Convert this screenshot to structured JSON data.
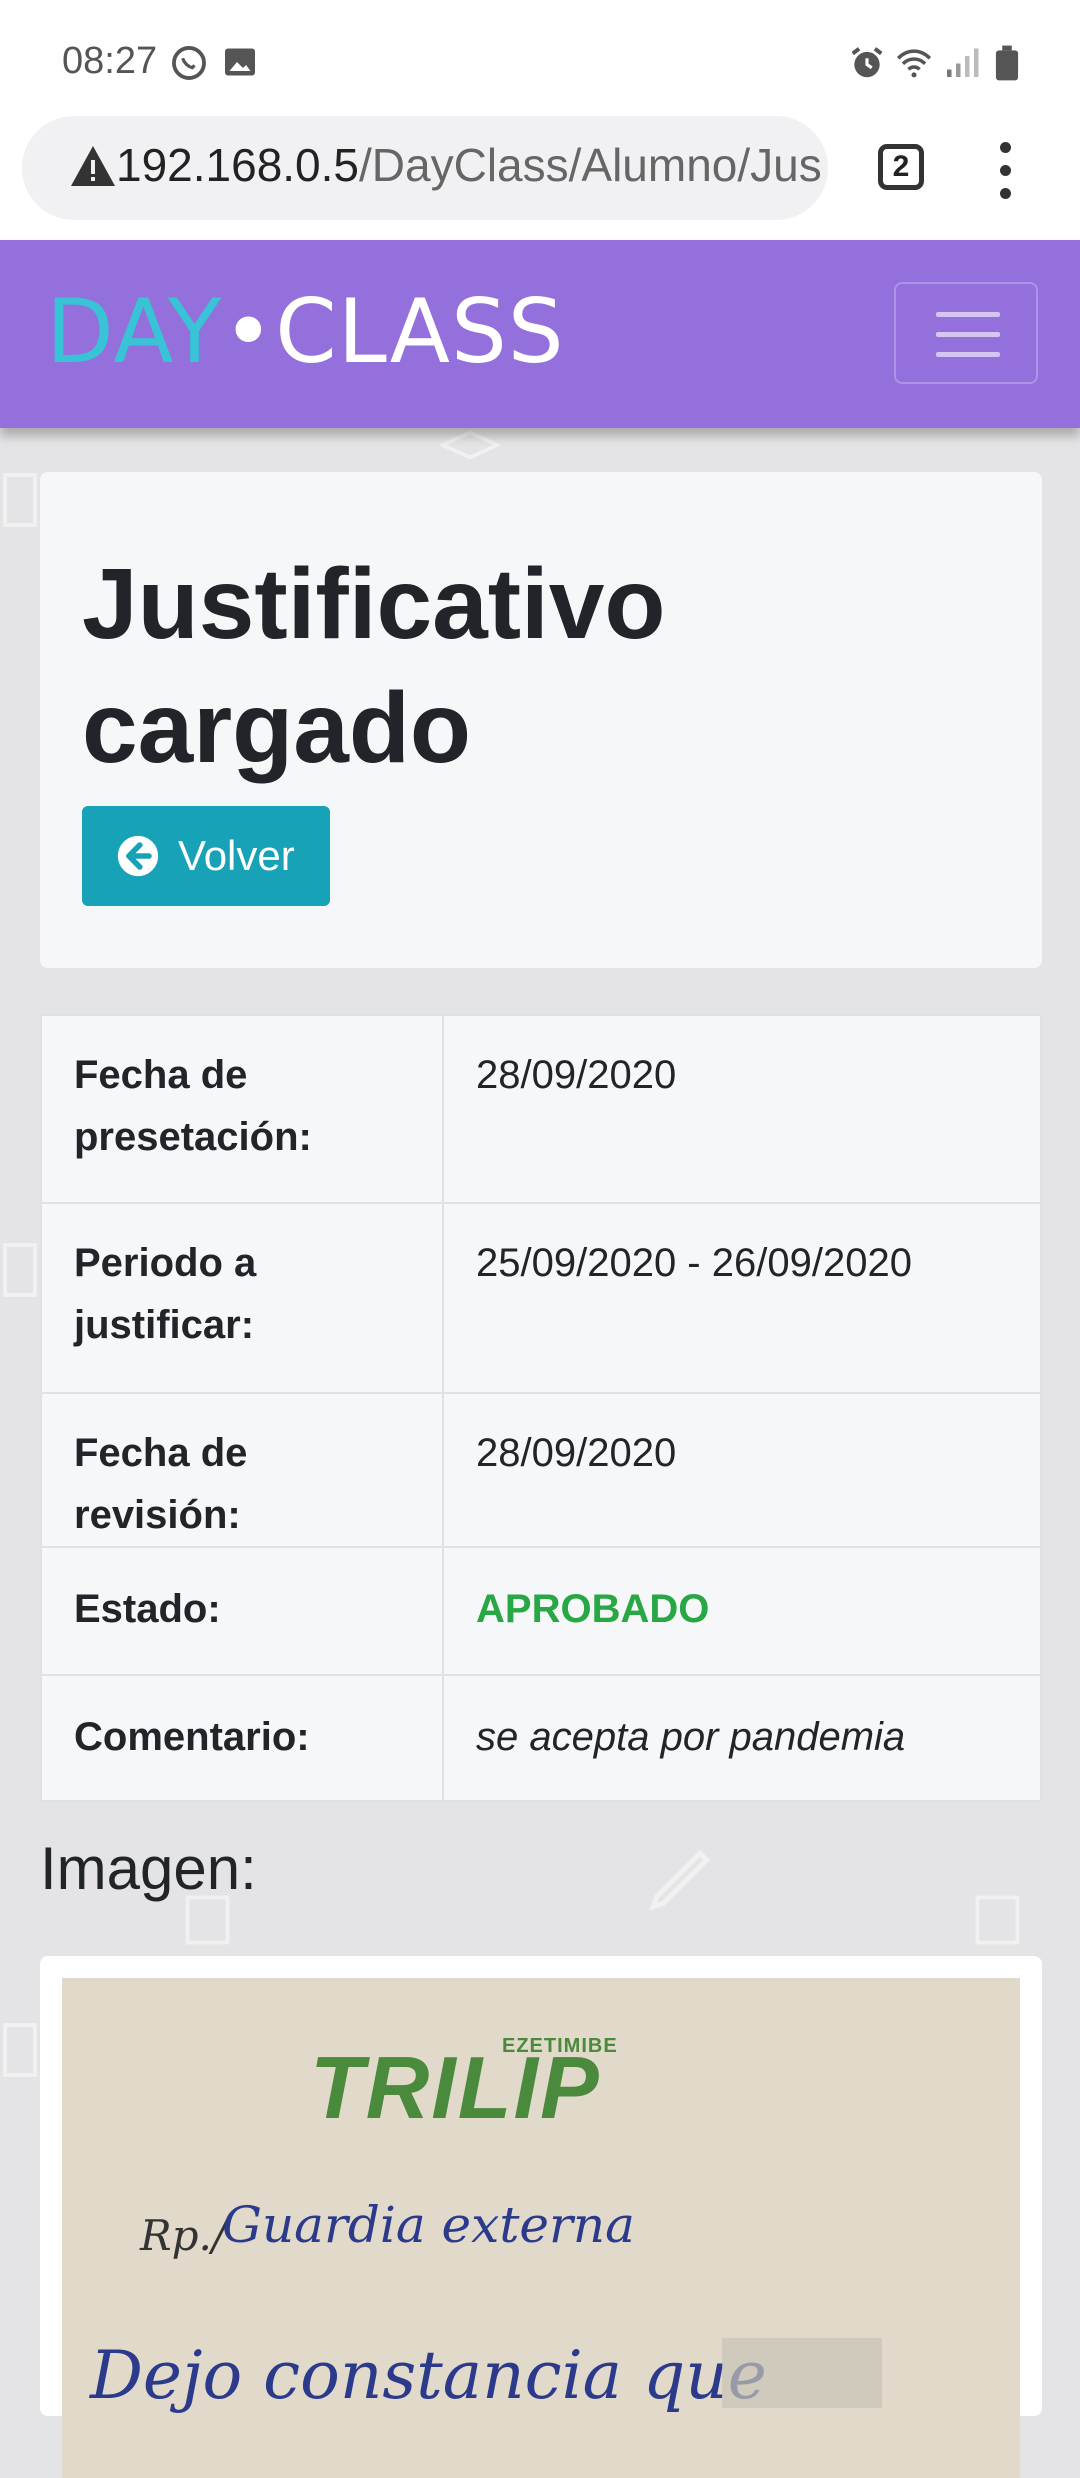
{
  "status_bar": {
    "time": "08:27"
  },
  "browser": {
    "url_host": "192.168.0.5",
    "url_path": "/DayClass/Alumno/Jus",
    "tab_count": "2"
  },
  "navbar": {
    "brand_day": "DAY",
    "brand_dot": "•",
    "brand_class": "CLASS"
  },
  "header": {
    "title": "Justificativo cargado",
    "back_label": "Volver"
  },
  "details": [
    {
      "label": "Fecha de presetación:",
      "value": "28/09/2020"
    },
    {
      "label": "Periodo a justificar:",
      "value": "25/09/2020 - 26/09/2020"
    },
    {
      "label": "Fecha de revisión:",
      "value": "28/09/2020"
    },
    {
      "label": "Estado:",
      "value": "APROBADO"
    },
    {
      "label": "Comentario:",
      "value": "se acepta por pandemia"
    }
  ],
  "image_section": {
    "heading": "Imagen:",
    "doc_brand_small": "EZETIMIBE",
    "doc_brand": "TRILIP",
    "doc_line1_prefix": "Rp./",
    "doc_line1": "Guardia externa",
    "doc_line2": "Dejo constancia que"
  },
  "colors": {
    "navbar": "#9370db",
    "brand_day": "#38c3d6",
    "button": "#17a2b8",
    "approved": "#28a745"
  }
}
